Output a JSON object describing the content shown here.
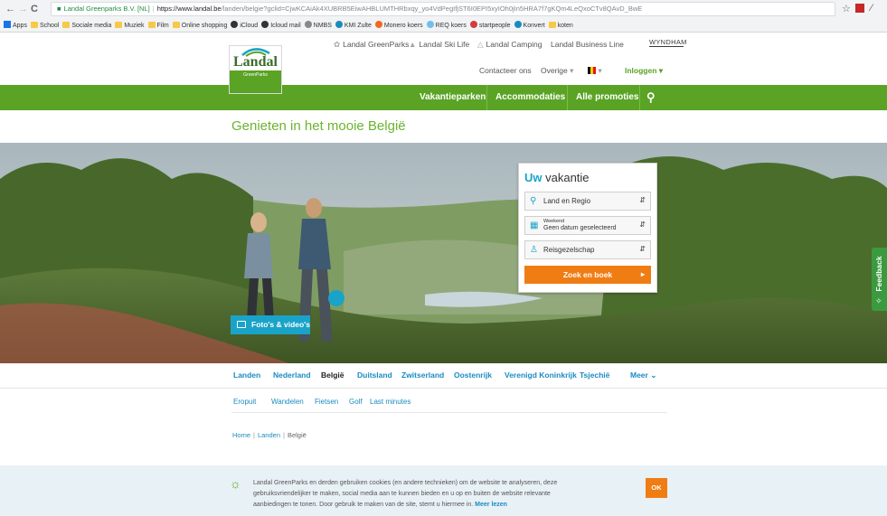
{
  "browser": {
    "back": "←",
    "forward": "→",
    "reload": "C",
    "secure_label": "Landal Greenparks B.V. [NL]",
    "url_host": "https://www.landal.be",
    "url_path": "/landen/belgie?gclid=CjwKCAiAk4XUBRB5EiwAHBLUMTHRbxqy_yo4VdPegIfjST6I0EPI5xyIOh0jIn5HRA7f7gKQm4LeQxoCTv8QAvD_BwE",
    "bookmarks": [
      {
        "label": "Apps",
        "icon": "apps-icon"
      },
      {
        "label": "School",
        "icon": "folder-icon"
      },
      {
        "label": "Sociale media",
        "icon": "folder-icon"
      },
      {
        "label": "Muziek",
        "icon": "folder-icon"
      },
      {
        "label": "Film",
        "icon": "folder-icon"
      },
      {
        "label": "Online shopping",
        "icon": "folder-icon"
      },
      {
        "label": "iCloud",
        "icon": "apple-icon"
      },
      {
        "label": "Icloud mail",
        "icon": "apple-icon"
      },
      {
        "label": "NMBS",
        "icon": "page-icon"
      },
      {
        "label": "KMI Zulte",
        "icon": "globe-icon"
      },
      {
        "label": "Monero koers",
        "icon": "monero-icon"
      },
      {
        "label": "REQ koers",
        "icon": "req-icon"
      },
      {
        "label": "startpeople",
        "icon": "gear-icon"
      },
      {
        "label": "Konvert",
        "icon": "globe-icon"
      },
      {
        "label": "koten",
        "icon": "folder-icon"
      }
    ]
  },
  "brands": {
    "greenparks": "Landal GreenParks",
    "skilife": "Landal Ski Life",
    "camping": "Landal Camping",
    "business": "Landal Business Line",
    "wyndham": "WYNDHAM"
  },
  "utility": {
    "contact": "Contacteer ons",
    "other": "Overige",
    "login": "Inloggen"
  },
  "logo": {
    "word": "Landal",
    "sub": "GreenParks"
  },
  "nav": {
    "parks": "Vakantieparken",
    "accommodations": "Accommodaties",
    "promotions": "Alle promoties"
  },
  "page": {
    "heading": "Genieten in het mooie België"
  },
  "hero": {
    "photo_button": "Foto's & video's"
  },
  "widget": {
    "title_accent": "Uw",
    "title_rest": " vakantie",
    "region": "Land en Regio",
    "date_small": "Weekend",
    "date_main": "Geen datum geselecteerd",
    "party": "Reisgezelschap",
    "search": "Zoek en boek"
  },
  "feedback": "Feedback",
  "countries": [
    "Landen",
    "Nederland",
    "België",
    "Duitsland",
    "Zwitserland",
    "Oostenrijk",
    "Verenigd Koninkrijk",
    "Tsjechië",
    "Meer"
  ],
  "subtabs": [
    "Eropuit",
    "Wandelen",
    "Fietsen",
    "Golf",
    "Last minutes"
  ],
  "breadcrumb": [
    "Home",
    "Landen",
    "België"
  ],
  "cookie": {
    "text": "Landal GreenParks en derden gebruiken cookies (en andere technieken) om de website te analyseren, deze gebruiksvriendelijker te maken, social media aan te kunnen bieden en u op en buiten de website relevante aanbiedingen te tonen. Door gebruik te maken van de site, stemt u hiermee in.",
    "more": "Meer lezen",
    "ok": "OK"
  },
  "colors": {
    "brand_green": "#5aa324",
    "accent_blue": "#1aa3c9",
    "cta_orange": "#f07d14"
  }
}
